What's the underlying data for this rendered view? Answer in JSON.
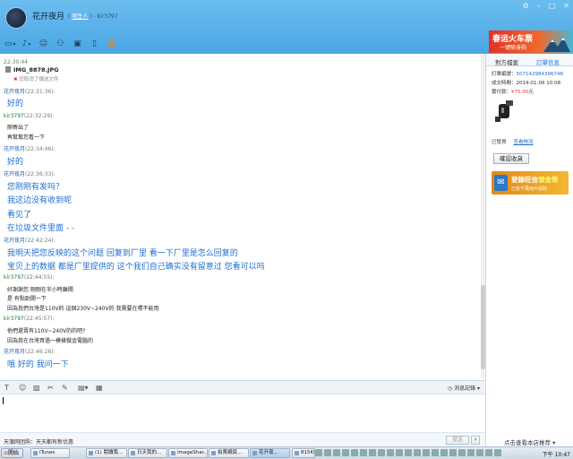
{
  "window": {
    "contact_name": "花开夜月",
    "sub_prefix": "(",
    "sub_link": "陌生人",
    "sub_suffix": ") - kir3797"
  },
  "toolbar": {
    "icons": [
      "folder-icon",
      "microphone-icon",
      "emoticon-icon",
      "users-icon",
      "screen-icon",
      "tablet-icon",
      "gift-icon"
    ]
  },
  "banner": {
    "title": "春运火车票",
    "subtitle": "一键随身购"
  },
  "chat": {
    "file_time": "22:30:44",
    "file_name": "IMG_8878.JPG",
    "file_status": "您取消了傳送文件",
    "messages": [
      {
        "sender": "花开夜月",
        "time": "(22:31:36):",
        "lines": [
          "好的"
        ],
        "style": "big"
      },
      {
        "sender": "kir3797",
        "time": "(22:32:29):",
        "lines": [
          "剛寄出了",
          "再幫幫您看一下"
        ],
        "style": "small"
      },
      {
        "sender": "花开夜月",
        "time": "(22:34:46):",
        "lines": [
          "好的"
        ],
        "style": "big"
      },
      {
        "sender": "花开夜月",
        "time": "(22:36:33):",
        "lines": [
          "您刚刚有发吗？",
          "我这边没有收到呢",
          "看见了",
          "在垃圾文件里面 - -"
        ],
        "style": "big"
      },
      {
        "sender": "花开夜月",
        "time": "(22:42:24):",
        "lines": [
          "我明天把您反映的这个问题 回复到厂里 看一下厂里是怎么回复的",
          "宝贝上的数据 都是厂里提供的 这个我们自己确实没有留意过 您看可以吗"
        ],
        "style": "big"
      },
      {
        "sender": "kir3797",
        "time": "(22:44:55):",
        "lines": [
          "好謝謝您 剛剛在半小時離開",
          "是 有點勁開一下",
          "因為我們台灣是110V的  這個230V~240V的 我需要在喂不能用"
        ],
        "style": "small"
      },
      {
        "sender": "kir3797",
        "time": "(22:45:57):",
        "lines": [
          "他們還賣有110V~240V的的吧?",
          "因為我在台灣買過一模樣做金電腦的"
        ],
        "style": "small"
      },
      {
        "sender": "花开夜月",
        "time": "(22:46:26):",
        "lines": [
          "哦 好的 我问一下"
        ],
        "style": "big"
      }
    ]
  },
  "input": {
    "history_label": "消息記錄",
    "value": ""
  },
  "bottom": {
    "notice": "天蒲网团购：天天都有新优惠",
    "close_label": "關閉",
    "send_label": "發送"
  },
  "panel": {
    "tab_a": "對方檔案",
    "tab_b": "訂單信息",
    "order_no_label": "訂單編號：",
    "order_no": "507142984396748",
    "deal_time_label": "成交時間：",
    "deal_time": "2014-01-06 10:08",
    "paid_label": "實付款：",
    "paid": "75.00",
    "paid_unit": "元",
    "status": "已發貨",
    "logistics_link": "查看物流",
    "confirm_label": "確認收貨",
    "promo_title_a": "登錄旺信",
    "promo_title_b": "領金幣",
    "promo_sub": "已有千萬用戶領取",
    "recommend_label": "点击查看本店推荐"
  },
  "taskbar": {
    "start_label": "開始",
    "tasks": [
      {
        "label": "iTunes",
        "active": false
      },
      {
        "label": "(1) 閱讀我...",
        "active": false
      },
      {
        "label": "日天我的...",
        "active": false
      },
      {
        "label": "ImageShar...",
        "active": false
      },
      {
        "label": "拍賣網頁...",
        "active": false
      },
      {
        "label": "花开夜...",
        "active": true
      },
      {
        "label": "815KMYLY",
        "active": false
      }
    ],
    "clock": "下午 10:47"
  },
  "colors": {
    "header": "#4aa6e4",
    "link": "#1f6fd0",
    "accent_red": "#e33333"
  }
}
